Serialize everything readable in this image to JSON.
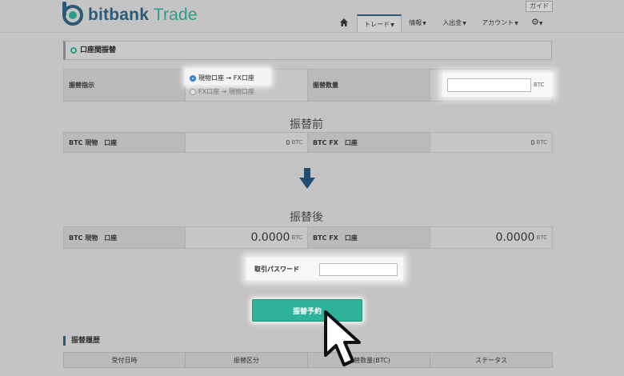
{
  "brand": {
    "name_bold": "bitbank",
    "name_light": " Trade"
  },
  "header": {
    "guide_label": "ガイド"
  },
  "nav": {
    "items": [
      {
        "label": "トレード",
        "active": true
      },
      {
        "label": "情報"
      },
      {
        "label": "入出金"
      },
      {
        "label": "アカウント"
      }
    ]
  },
  "section_title": "口座間振替",
  "transfer": {
    "direction_label": "振替指示",
    "option_spot_to_fx": "現物口座 → FX口座",
    "option_fx_to_spot": "FX口座 → 現物口座",
    "amount_label": "振替数量",
    "amount_value": "",
    "amount_unit": "BTC"
  },
  "before": {
    "heading": "振替前",
    "spot_label": "BTC 現物　口座",
    "spot_value": "0",
    "spot_unit": "BTC",
    "fx_label": "BTC FX　口座",
    "fx_value": "0",
    "fx_unit": "BTC"
  },
  "after": {
    "heading": "振替後",
    "spot_label": "BTC 現物　口座",
    "spot_value": "0.0000",
    "spot_unit": "BTC",
    "fx_label": "BTC FX　口座",
    "fx_value": "0.0000",
    "fx_unit": "BTC"
  },
  "password": {
    "label": "取引パスワード",
    "value": ""
  },
  "submit_label": "振替予約",
  "history": {
    "title": "振替履歴",
    "columns": [
      "受付日時",
      "振替区分",
      "振替数量(BTC)",
      "ステータス"
    ]
  },
  "colors": {
    "accent": "#2eb39a",
    "brand": "#2b5a77",
    "radio": "#2d7fd8"
  }
}
